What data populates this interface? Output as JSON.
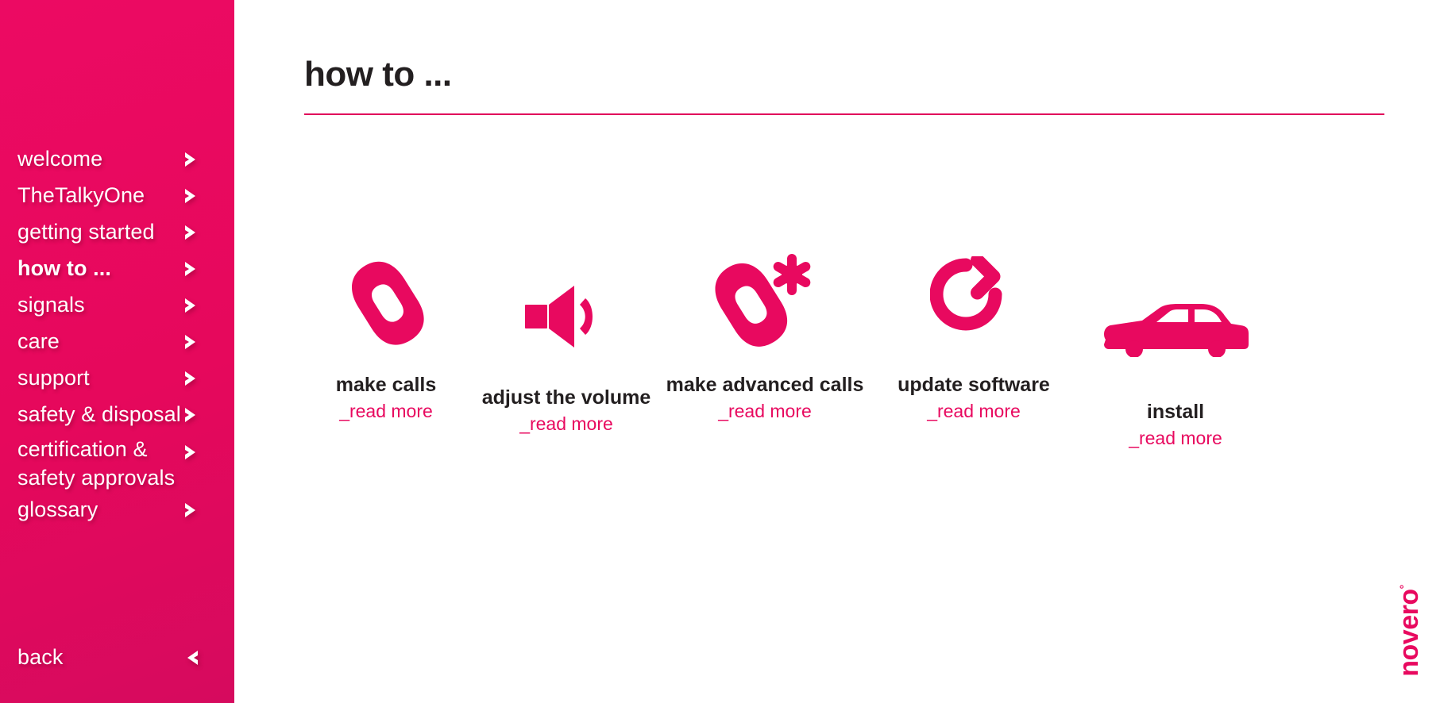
{
  "theme": {
    "accent": "#e8095f",
    "rule": "#e0005a",
    "text_dark": "#231f20",
    "sidebar_text": "#ffffff"
  },
  "sidebar": {
    "items": [
      {
        "label": "welcome",
        "active": false,
        "icon": "chevron-right-icon"
      },
      {
        "label": "TheTalkyOne",
        "active": false,
        "icon": "chevron-right-icon"
      },
      {
        "label": "getting started",
        "active": false,
        "icon": "chevron-right-icon"
      },
      {
        "label": "how to ...",
        "active": true,
        "icon": "chevron-right-icon"
      },
      {
        "label": "signals",
        "active": false,
        "icon": "chevron-right-icon"
      },
      {
        "label": "care",
        "active": false,
        "icon": "chevron-right-icon"
      },
      {
        "label": "support",
        "active": false,
        "icon": "chevron-right-icon"
      },
      {
        "label": "safety & disposal",
        "active": false,
        "icon": "chevron-right-icon"
      },
      {
        "label": "certification &\nsafety approvals",
        "active": false,
        "icon": "chevron-right-icon"
      },
      {
        "label": "glossary",
        "active": false,
        "icon": "chevron-right-icon"
      }
    ],
    "back": {
      "label": "back",
      "icon": "chevron-left-icon"
    }
  },
  "header": {
    "title": "how to ..."
  },
  "main": {
    "tiles": [
      {
        "icon": "phone-handset-icon",
        "title": "make calls",
        "link": "_read more"
      },
      {
        "icon": "speaker-volume-icon",
        "title": "adjust the volume",
        "link": "_read more"
      },
      {
        "icon": "phone-handset-asterisk-icon",
        "title": "make advanced calls",
        "link": "_read more"
      },
      {
        "icon": "refresh-circular-arrow-icon",
        "title": "update software",
        "link": "_read more"
      },
      {
        "icon": "car-side-icon",
        "title": "install",
        "link": "_read more"
      }
    ]
  },
  "footer": {
    "logo": "novero",
    "logo_mark": "°"
  }
}
